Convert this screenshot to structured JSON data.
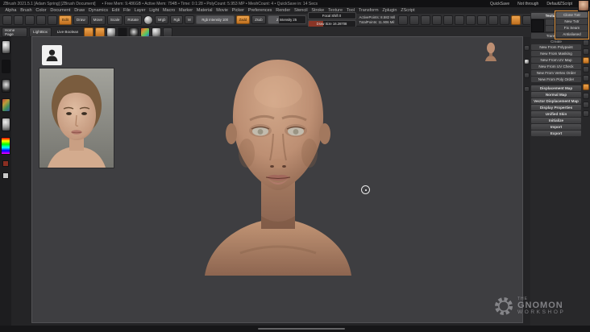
{
  "titlebar": {
    "app_title": "ZBrush 2021.5.1 [Adam Spring]  [ZBrush Document]",
    "stats": "• Free Mem: 9.486GB • Active Mem: 794B • Time: 0:1:28 • PolyCount: 5.953 MP • MeshCount: 4 • QuickSave in: 14 Secs",
    "quick_save": "QuickSave",
    "session": "Not through",
    "script": "DefaultZScript"
  },
  "menus": [
    "Alpha",
    "Brush",
    "Color",
    "Document",
    "Draw",
    "Dynamics",
    "Edit",
    "File",
    "Layer",
    "Light",
    "Macro",
    "Marker",
    "Material",
    "Movie",
    "Picker",
    "Preferences",
    "Render",
    "Stencil",
    "Stroke",
    "Texture",
    "Tool",
    "Transform",
    "Zplugin",
    "ZScript"
  ],
  "shelf": {
    "edit": "Edit",
    "draw": "Draw",
    "move": "Move",
    "scale": "Scale",
    "rotate": "Rotate",
    "mrgb": "Mrgb",
    "rgb": "Rgb",
    "m": "M",
    "zadd": "Zadd",
    "zsub": "Zsub",
    "rgb_intensity": "Rgb Intensity 100",
    "z_intensity": "Z Intensity 25",
    "focal_shift": "Focal Shift 0",
    "draw_size": "Draw Size 16.28708",
    "active_points": "ActivePoints: 8.582 Mil",
    "total_points": "TotalPoints: 11.906 Mil"
  },
  "subshelf": {
    "home_page": "Home Page",
    "lightbox": "LightBox",
    "live_boolean": "Live Boolean"
  },
  "tool_panel": {
    "section_title": "Texture Map",
    "transparent": "Transparent",
    "create_label": "Create",
    "popup_items": [
      "Clone Txtr",
      "New Txtr",
      "Fix Seam",
      "Antialiased"
    ],
    "create_items": [
      "New From Polypaint",
      "New From Masking",
      "New From UV Map",
      "New From UV Check",
      "New From Vertex Order",
      "New From Poly Order"
    ],
    "sections": [
      "Displacement Map",
      "Normal Map",
      "Vector Displacement Map",
      "Display Properties",
      "Unified Skin",
      "Initialize",
      "Import",
      "Export"
    ]
  },
  "watermark": {
    "the": "THE",
    "gnomon": "GNOMON",
    "workshop": "WORKSHOP"
  },
  "icons": {
    "person-icon": "silhouette shape",
    "gear-icon": "toothed ring",
    "brush-icon": "sphere thumbnail",
    "stroke-icon": "curve thumbnail",
    "alpha-icon": "radial gray thumbnail",
    "texture-icon": "rainbow thumbnail",
    "material-icon": "sphere thumbnail"
  },
  "colors": {
    "accent_orange": "#d9832e",
    "canvas_bg": "#3e3e41",
    "panel_bg": "#28282a",
    "skin": "#bd8f73"
  }
}
